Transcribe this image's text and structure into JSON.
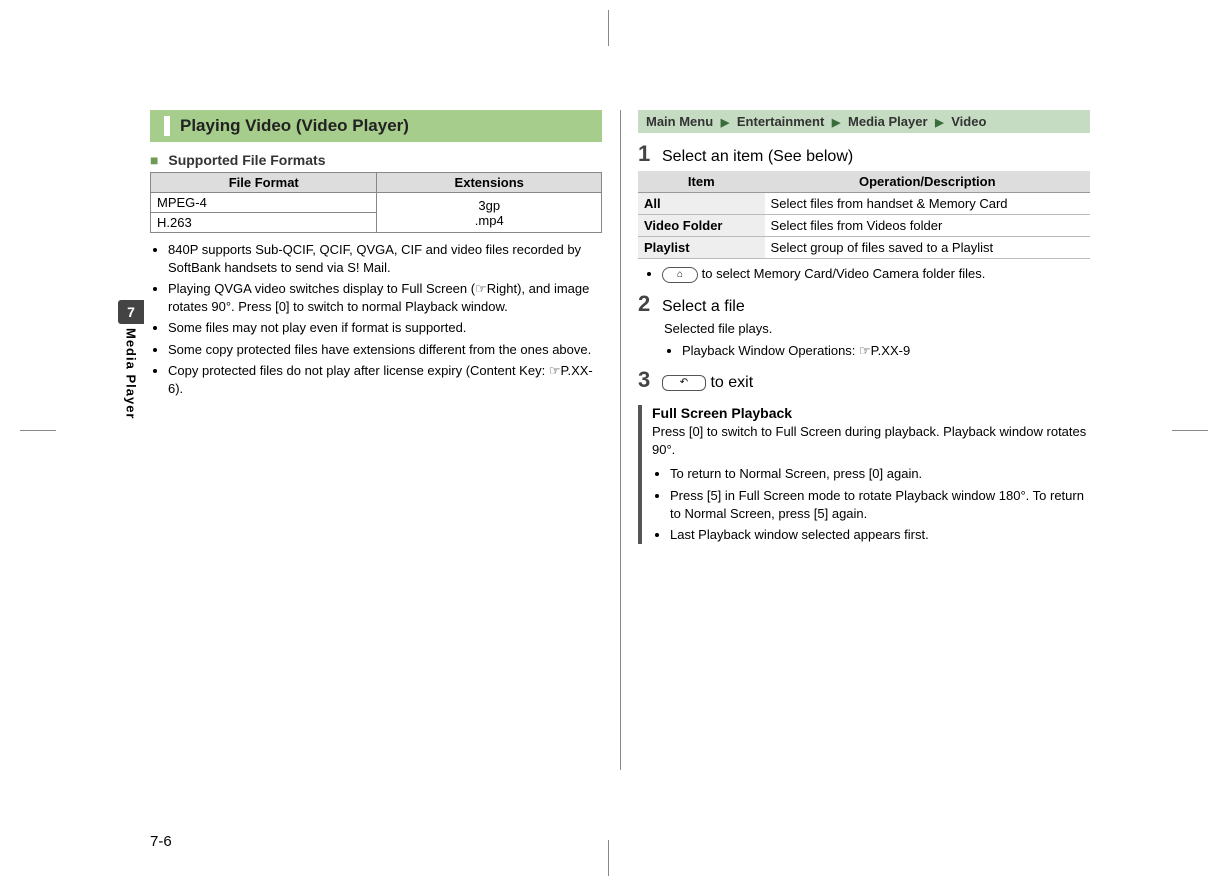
{
  "sidebar": {
    "chapter": "7",
    "label": "Media Player"
  },
  "page_number": "7-6",
  "left": {
    "heading": "Playing Video (Video Player)",
    "subheading": "Supported File Formats",
    "table": {
      "headers": [
        "File Format",
        "Extensions"
      ],
      "rows": [
        {
          "format": "MPEG-4",
          "ext": "3gp"
        },
        {
          "format": "H.263",
          "ext": ".mp4"
        }
      ]
    },
    "notes": [
      "840P supports Sub-QCIF, QCIF, QVGA, CIF and video files recorded by SoftBank handsets to send via S! Mail.",
      "Playing QVGA video switches display to Full Screen (☞Right), and image rotates 90°. Press [0] to switch to normal Playback window.",
      "Some files may not play even if format is supported.",
      "Some copy protected files have extensions different from the ones above.",
      "Copy protected files do not play after license expiry (Content Key: ☞P.XX-6)."
    ]
  },
  "right": {
    "breadcrumb": [
      "Main Menu",
      "Entertainment",
      "Media Player",
      "Video"
    ],
    "step1": {
      "num": "1",
      "text": "Select an item (See below)"
    },
    "items_table": {
      "headers": [
        "Item",
        "Operation/Description"
      ],
      "rows": [
        {
          "item": "All",
          "desc": "Select files from handset & Memory Card"
        },
        {
          "item": "Video Folder",
          "desc": "Select files from Videos folder"
        },
        {
          "item": "Playlist",
          "desc": "Select group of files saved to a Playlist"
        }
      ]
    },
    "note_after_table": "to select Memory Card/Video Camera folder files.",
    "note_after_table_key": "⌂",
    "step2": {
      "num": "2",
      "text": "Select a file"
    },
    "step2_sub1": "Selected file plays.",
    "step2_sub2": "Playback Window Operations: ☞P.XX-9",
    "step3": {
      "num": "3",
      "key": "↶",
      "text": "to exit"
    },
    "callout": {
      "title": "Full Screen Playback",
      "body": "Press  [0] to switch to Full Screen during playback. Playback window rotates 90°.",
      "bullets": [
        "To return to Normal Screen, press [0] again.",
        "Press [5] in Full Screen mode to rotate Playback window 180°. To return to Normal Screen, press [5] again.",
        "Last Playback window selected appears first."
      ]
    }
  }
}
